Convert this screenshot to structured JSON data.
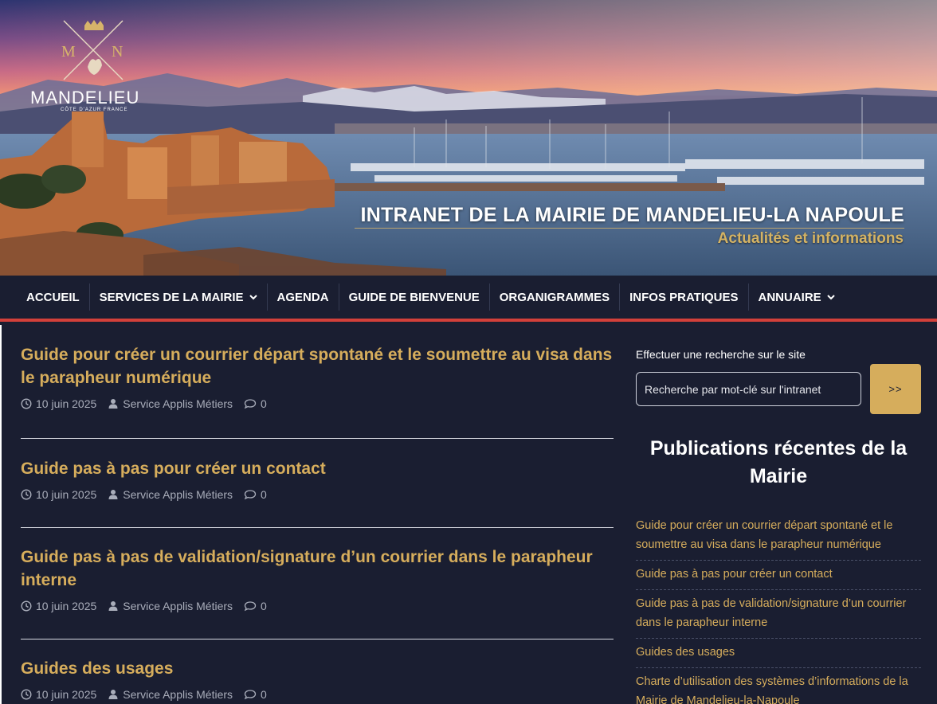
{
  "banner": {
    "logo_name": "MANDELIEU",
    "logo_subtitle": "CÔTE D'AZUR FRANCE",
    "logo_letter_left": "M",
    "logo_letter_right": "N",
    "title": "INTRANET DE LA MAIRIE DE MANDELIEU-LA NAPOULE",
    "subtitle": "Actualités et informations"
  },
  "nav": {
    "items": [
      {
        "label": "ACCUEIL"
      },
      {
        "label": "SERVICES DE LA MAIRIE",
        "icon": "chevron-down-icon"
      },
      {
        "label": "AGENDA"
      },
      {
        "label": "GUIDE DE BIENVENUE"
      },
      {
        "label": "ORGANIGRAMMES"
      },
      {
        "label": "INFOS PRATIQUES"
      },
      {
        "label": "ANNUAIRE",
        "icon": "chevron-down-icon"
      }
    ],
    "accent_color": "#d3403a"
  },
  "posts": [
    {
      "title": "Guide pour créer un courrier départ spontané et le soumettre au visa dans le parapheur numérique",
      "date": "10 juin 2025",
      "author": "Service Applis Métiers",
      "comments": "0"
    },
    {
      "title": "Guide pas à pas pour créer un contact",
      "date": "10 juin 2025",
      "author": "Service Applis Métiers",
      "comments": "0"
    },
    {
      "title": "Guide pas à pas de validation/signature d’un courrier dans le parapheur interne",
      "date": "10 juin 2025",
      "author": "Service Applis Métiers",
      "comments": "0"
    },
    {
      "title": "Guides des usages",
      "date": "10 juin 2025",
      "author": "Service Applis Métiers",
      "comments": "0"
    }
  ],
  "sidebar": {
    "search_label": "Effectuer une recherche sur le site",
    "search_placeholder": "Recherche par mot-clé sur l'intranet",
    "search_button": ">>",
    "widget_title": "Publications récentes de la Mairie",
    "recent": [
      "Guide pour créer un courrier départ spontané et le soumettre au visa dans le parapheur numérique",
      "Guide pas à pas pour créer un contact",
      "Guide pas à pas de validation/signature d’un courrier dans le parapheur interne",
      "Guides des usages",
      "Charte d’utilisation des systèmes d’informations de la Mairie de Mandelieu-la-Napoule"
    ]
  },
  "colors": {
    "background": "#1a1e31",
    "gold": "#d6ad5c",
    "meta_text": "#a9adba"
  }
}
